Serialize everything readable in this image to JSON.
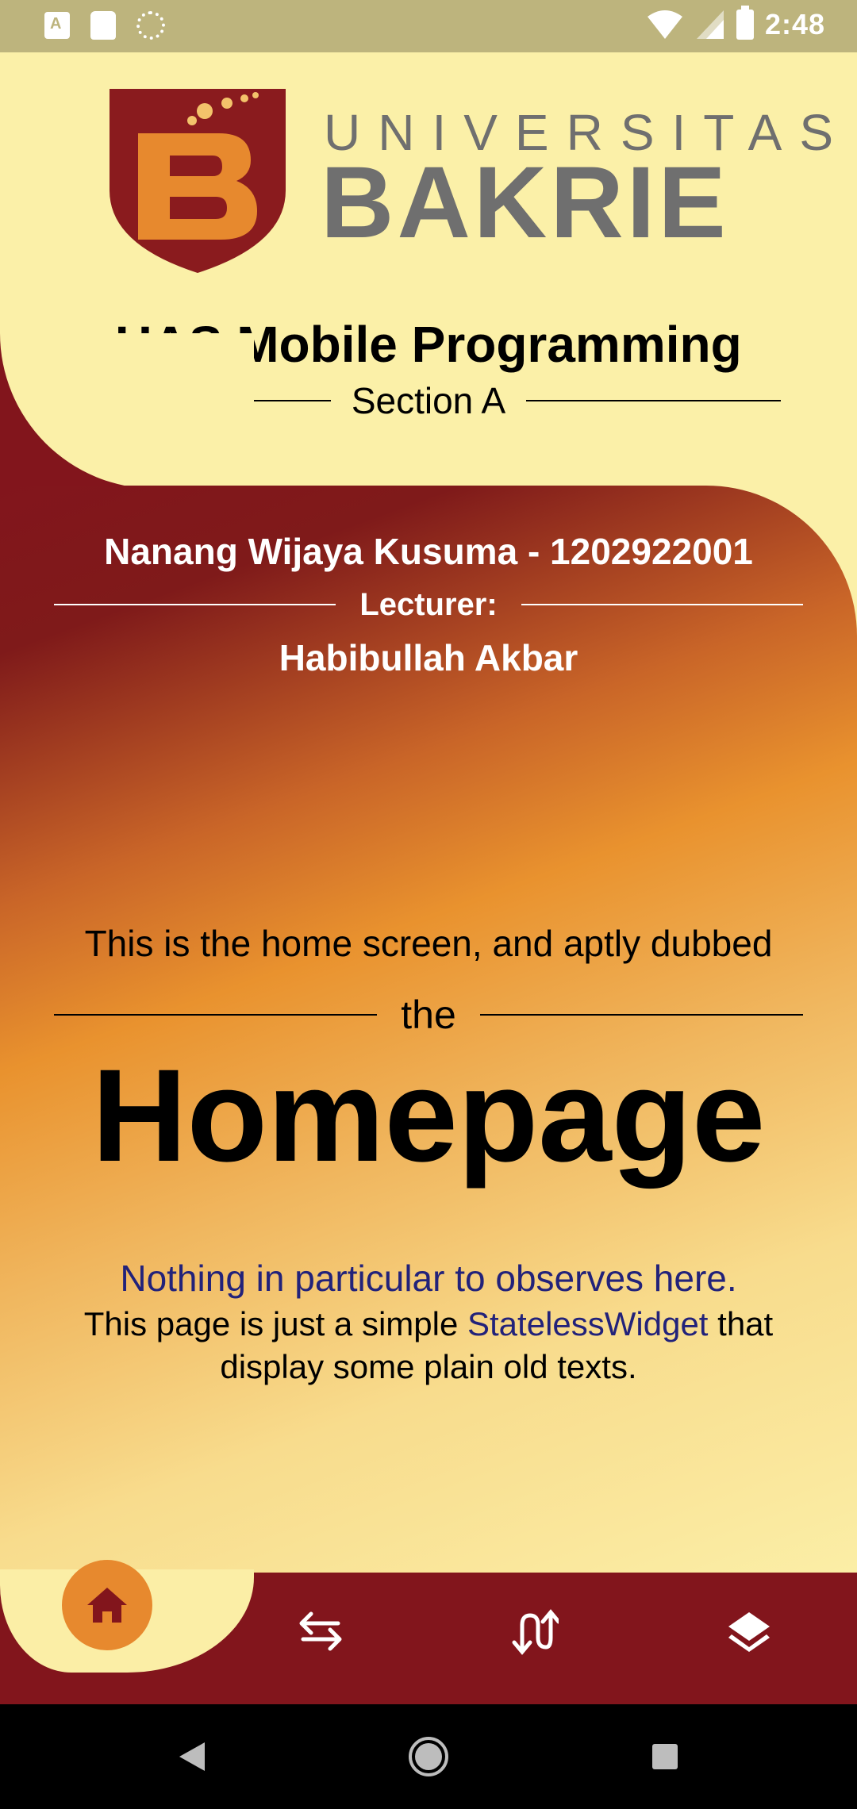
{
  "status_bar": {
    "time": "2:48",
    "icons": [
      "a-badge-icon",
      "sd-card-icon",
      "sync-circle-icon",
      "wifi-icon",
      "signal-icon",
      "battery-icon"
    ]
  },
  "header": {
    "logo": {
      "emblem_letter": "B",
      "line1": "UNIVERSITAS",
      "line2": "BAKRIE",
      "colors": {
        "shield": "#8a1b1e",
        "letter": "#e7892e",
        "text": "#6f6f6f"
      }
    },
    "title": "UAS Mobile Programming",
    "section_label": "Section A"
  },
  "main": {
    "student": "Nanang Wijaya Kusuma - 1202922001",
    "lecturer_label": "Lecturer:",
    "lecturer_name": "Habibullah Akbar",
    "intro": "This is the home screen, and aptly dubbed",
    "the_label": "the",
    "big_title": "Homepage",
    "note": "Nothing in particular to observes here.",
    "desc_part1": "This page is just a simple ",
    "desc_highlight": "StatelessWidget",
    "desc_part2": " that display some plain old texts."
  },
  "bottom_nav": {
    "items": [
      {
        "icon": "home-icon",
        "active": true
      },
      {
        "icon": "swap-arrows-icon",
        "active": false
      },
      {
        "icon": "route-arrows-icon",
        "active": false
      },
      {
        "icon": "layers-icon",
        "active": false
      }
    ]
  },
  "system_nav": {
    "buttons": [
      "back-icon",
      "home-circle-icon",
      "recents-square-icon"
    ]
  },
  "colors": {
    "header_bg": "#fbf0a8",
    "brand_maroon": "#82151c",
    "accent_orange": "#e7892e",
    "link_blue": "#22227a",
    "status_bar": "#bdb47d"
  }
}
